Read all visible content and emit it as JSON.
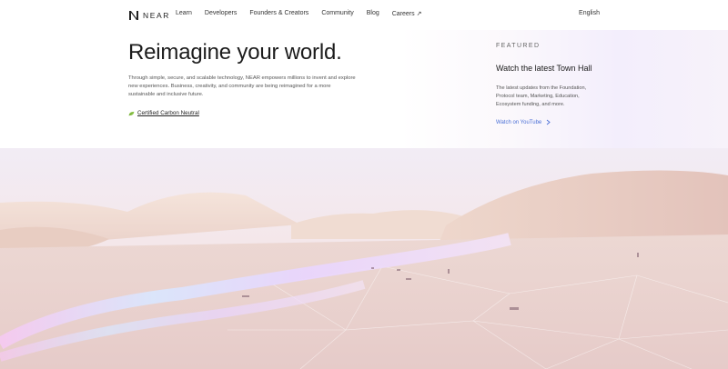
{
  "nav": {
    "logo_text": "NEAR",
    "links": [
      "Learn",
      "Developers",
      "Founders & Creators",
      "Community",
      "Blog",
      "Careers ↗"
    ],
    "language": "English"
  },
  "hero": {
    "title": "Reimagine your world.",
    "description": "Through simple, secure, and scalable technology, NEAR empowers millions to invent and explore new experiences. Business, creativity, and community are being reimagined for a more sustainable and inclusive future.",
    "carbon_link": "Certified Carbon Neutral"
  },
  "featured": {
    "eyebrow": "FEATURED",
    "title": "Watch the latest Town Hall",
    "description": "The latest updates from the Foundation, Protocol team, Marketing, Education, Ecosystem funding, and more.",
    "link": "Watch on YouTube"
  },
  "colors": {
    "accent_link": "#4a6fd6",
    "leaf": "#8bc34a"
  }
}
